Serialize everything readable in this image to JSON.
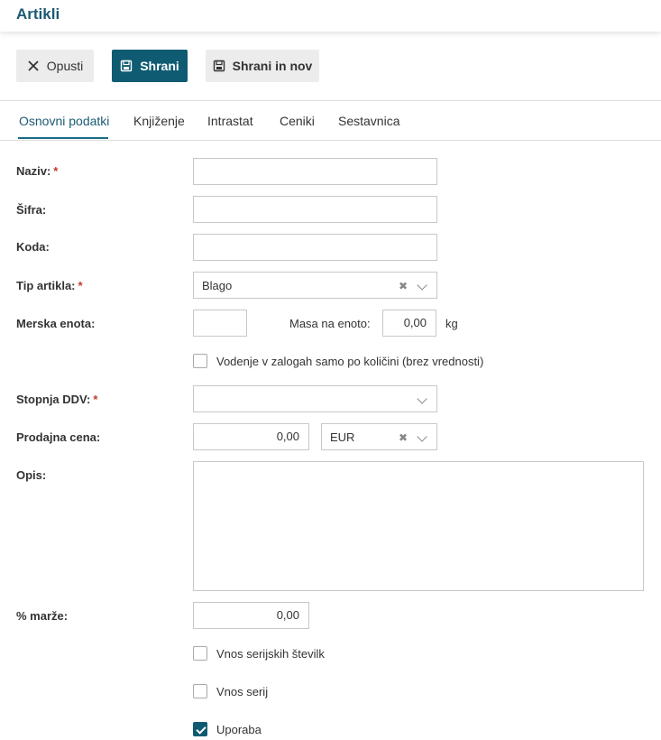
{
  "header": {
    "title": "Artikli"
  },
  "toolbar": {
    "cancel_label": "Opusti",
    "save_label": "Shrani",
    "save_new_label": "Shrani in nov"
  },
  "tabs": [
    "Osnovni podatki",
    "Knjiženje",
    "Intrastat",
    "Ceniki",
    "Sestavnica"
  ],
  "active_tab": "Osnovni podatki",
  "form": {
    "naziv": {
      "label": "Naziv:",
      "required_mark": "*",
      "value": ""
    },
    "sifra": {
      "label": "Šifra:",
      "value": ""
    },
    "koda": {
      "label": "Koda:",
      "value": ""
    },
    "tip_artikla": {
      "label": "Tip artikla:",
      "required_mark": "*",
      "value": "Blago"
    },
    "merska_enota": {
      "label": "Merska enota:",
      "value": ""
    },
    "masa": {
      "label": "Masa na enoto:",
      "value": "0,00",
      "unit": "kg"
    },
    "vodenje": {
      "label": "Vodenje v zalogah samo po količini (brez vrednosti)",
      "checked": false
    },
    "stopnja_ddv": {
      "label": "Stopnja DDV:",
      "required_mark": "*",
      "value": ""
    },
    "prodajna_cena": {
      "label": "Prodajna cena:",
      "value": "0,00",
      "currency": "EUR"
    },
    "opis": {
      "label": "Opis:",
      "value": ""
    },
    "marza": {
      "label": "% marže:",
      "value": "0,00"
    },
    "serijske": {
      "label": "Vnos serijskih številk",
      "checked": false
    },
    "serije": {
      "label": "Vnos serij",
      "checked": false
    },
    "uporaba": {
      "label": "Uporaba",
      "checked": true
    }
  },
  "colors": {
    "accent": "#0f5b72",
    "title": "#1b5a73",
    "required": "#c0392b"
  },
  "icons": {
    "cancel": "close-icon",
    "save": "save-icon",
    "save_new": "save-new-icon",
    "clear": "clear-icon",
    "dropdown": "chevron-down-icon"
  }
}
